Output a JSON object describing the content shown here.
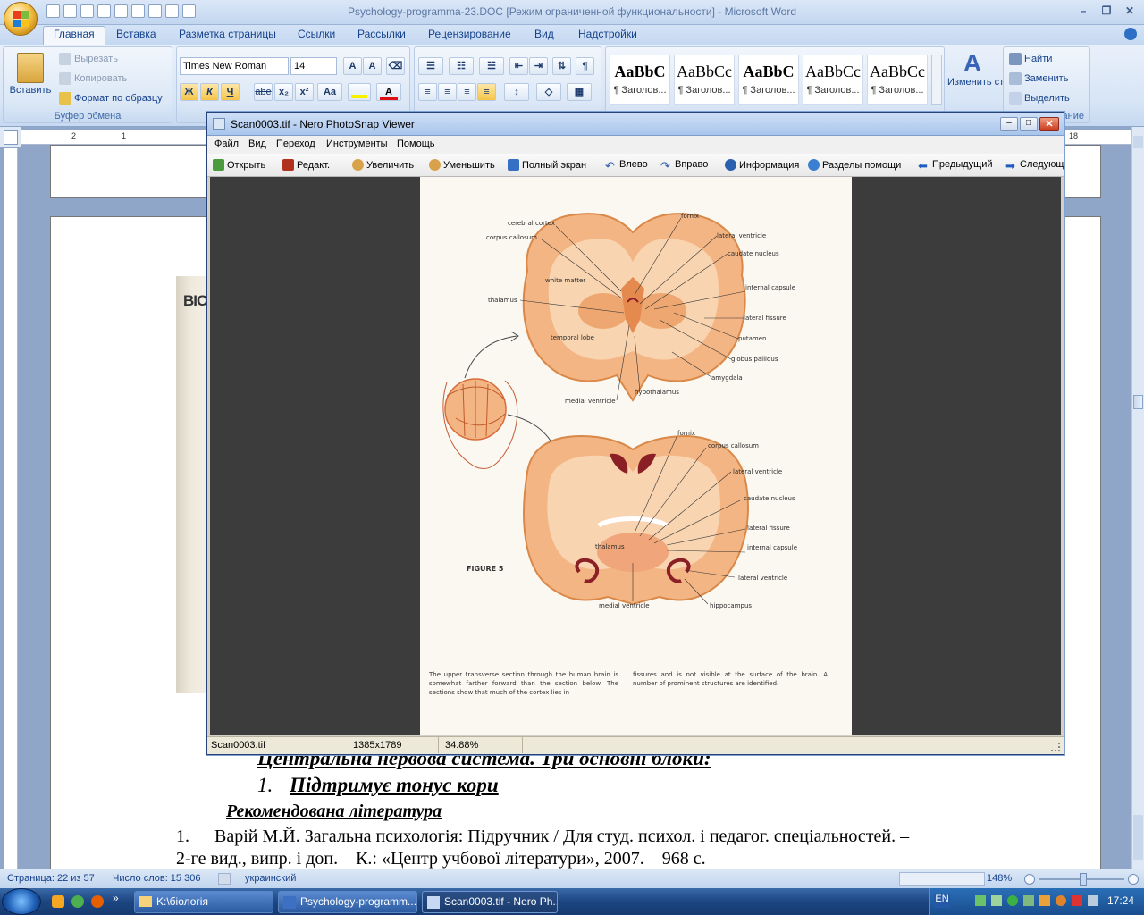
{
  "word": {
    "window_title": "Psychology-programma-23.DOC [Режим ограниченной функциональности] - Microsoft Word",
    "tabs": [
      "Главная",
      "Вставка",
      "Разметка страницы",
      "Ссылки",
      "Рассылки",
      "Рецензирование",
      "Вид",
      "Надстройки"
    ],
    "clipboard": {
      "paste": "Вставить",
      "cut": "Вырезать",
      "copy": "Копировать",
      "format_painter": "Формат по образцу",
      "group_label": "Буфер обмена"
    },
    "font": {
      "family": "Times New Roman",
      "size": "14",
      "bold": "Ж",
      "italic": "К",
      "underline": "Ч",
      "strike": "abe",
      "subscript": "x₂",
      "superscript": "x²",
      "case": "Aa"
    },
    "styles": [
      {
        "sample": "AaBbC",
        "name": "¶ Заголов..."
      },
      {
        "sample": "AaBbCc",
        "name": "¶ Заголов..."
      },
      {
        "sample": "AaBbC",
        "name": "¶ Заголов..."
      },
      {
        "sample": "AaBbCc",
        "name": "¶ Заголов..."
      },
      {
        "sample": "AaBbCc",
        "name": "¶ Заголов..."
      }
    ],
    "change_styles": "Изменить стили",
    "editing": {
      "find": "Найти",
      "replace": "Заменить",
      "select": "Выделить",
      "group_label": "вание"
    },
    "document": {
      "line1": "Центральна нервова система.  Три основні блоки:",
      "line2_num": "1.",
      "line2": "Підтримує тонус кори",
      "heading": "Рекомендована література",
      "ref_num": "1.",
      "ref1": "Варій М.Й. Загальна психологія: Підручник / Для студ. психол. і педагог. спеціальностей. –",
      "ref2": "2-ге вид., випр. і доп. – К.: «Центр учбової літератури», 2007. – 968 с.",
      "behind_image_title": "BIO"
    },
    "status": {
      "page": "Страница: 22 из 57",
      "words": "Число слов: 15 306",
      "language": "украинский",
      "zoom": "148%"
    }
  },
  "ruler": {
    "left_mark": "2",
    "mid_mark": "1",
    "right_mark": "18"
  },
  "nero": {
    "title": "Scan0003.tif - Nero PhotoSnap Viewer",
    "menu": [
      "Файл",
      "Вид",
      "Переход",
      "Инструменты",
      "Помощь"
    ],
    "toolbar": [
      "Открыть",
      "Редакт.",
      "Увеличить",
      "Уменьшить",
      "Полный экран",
      "Влево",
      "Вправо",
      "Информация",
      "Разделы помощи",
      "Предыдущий",
      "Следующ"
    ],
    "status": {
      "file": "Scan0003.tif",
      "dims": "1385x1789",
      "zoom": "34.88%"
    },
    "scan": {
      "figure_label": "FIGURE 5",
      "upper_labels": [
        "cerebral cortex",
        "corpus callosum",
        "white matter",
        "thalamus",
        "temporal lobe",
        "medial ventricle",
        "hypothalamus",
        "fornix",
        "lateral ventricle",
        "caudate nucleus",
        "internal capsule",
        "lateral fissure",
        "putamen",
        "globus pallidus",
        "amygdala"
      ],
      "lower_labels": [
        "fornix",
        "corpus callosum",
        "lateral ventricle",
        "caudate nucleus",
        "lateral fissure",
        "internal capsule",
        "thalamus",
        "lateral ventricle",
        "hippocampus",
        "medial ventricle"
      ],
      "caption_left": "The upper transverse section through the human brain is somewhat farther forward than the section below. The sections show that much of the cortex lies in",
      "caption_right": "fissures and is not visible at the surface of the brain. A number of prominent structures are identified."
    }
  },
  "taskbar": {
    "items": [
      "K:\\біологія",
      "Psychology-programm...",
      "Scan0003.tif - Nero Ph..."
    ],
    "lang": "EN",
    "clock": "17:24"
  },
  "colors": {
    "ribbon": "#dbe7f6",
    "brain": "#f4b584",
    "brain_dark": "#e8924f",
    "ventricle": "#8a1f25"
  }
}
